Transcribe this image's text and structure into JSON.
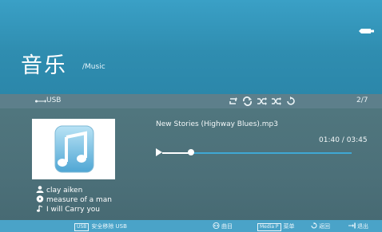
{
  "header": {
    "title": "音乐",
    "subtitle": "/Music",
    "device_icon": "usb-drive-icon"
  },
  "toolbar": {
    "source_icon": "usb-icon",
    "source_label": "USB",
    "mode_icons": [
      "repeat-one-icon",
      "repeat-all-icon",
      "shuffle-icon",
      "shuffle-repeat-icon",
      "repeat-off-icon"
    ],
    "track_counter": "2/7"
  },
  "now_playing": {
    "album_art_icon": "music-note-icon",
    "song_title": "New Stories (Highway Blues).mp3",
    "time_readout": "01:40 / 03:45",
    "progress_fraction": 0.15,
    "artist": "clay aiken",
    "album": "measure of a man",
    "track": "I will Carry you"
  },
  "footer": {
    "safe_remove_key": "USB",
    "safe_remove_label": "安全移除 USB",
    "track_key_icon": "left-right-keys-icon",
    "track_label": "曲目",
    "menu_key": "Media P",
    "menu_label": "菜单",
    "back_label": "返回",
    "exit_label": "退出"
  },
  "colors": {
    "header": "#2f8db0",
    "toolbar": "#5d7f8b",
    "main": "#4c7079",
    "footer": "#4aa3c8",
    "progress": "#3fa8d4"
  }
}
